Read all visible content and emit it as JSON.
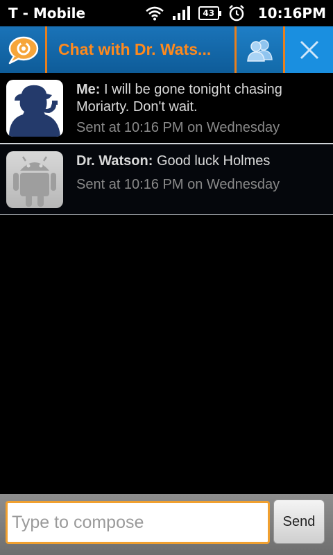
{
  "status_bar": {
    "carrier": "T - Mobile",
    "battery_level": "43",
    "time": "10:16PM"
  },
  "title_bar": {
    "title": "Chat with Dr. Wats...",
    "accent_color": "#ff8a1d",
    "icons": [
      "chat-logo-icon",
      "buddies-icon",
      "close-icon"
    ]
  },
  "messages": [
    {
      "sender": "Me:",
      "text": "I will be gone tonight chasing Moriarty.  Don't wait.",
      "time": "Sent at 10:16 PM on Wednesday",
      "avatar": "sherlock-silhouette"
    },
    {
      "sender": "Dr. Watson:",
      "text": "Good luck Holmes",
      "time": "Sent at 10:16 PM on Wednesday",
      "avatar": "android-default"
    }
  ],
  "compose": {
    "placeholder": "Type to compose",
    "value": "",
    "send_label": "Send"
  }
}
